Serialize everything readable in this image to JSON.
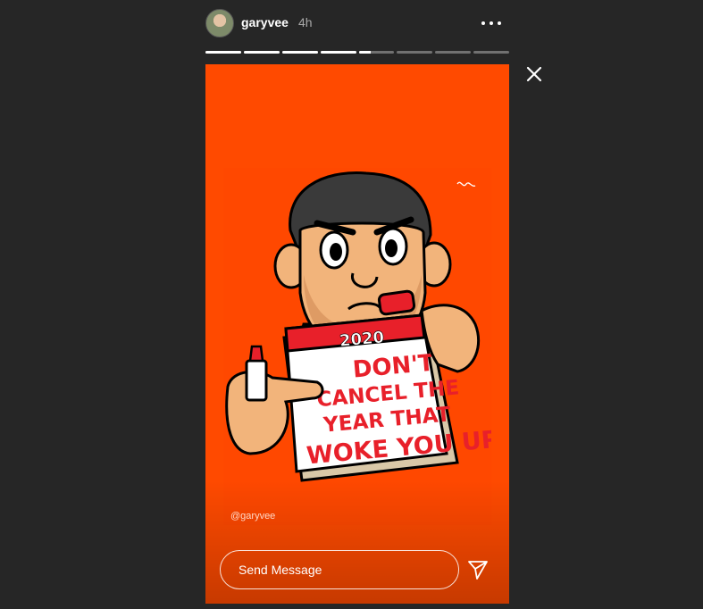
{
  "header": {
    "username": "garyvee",
    "time": "4h"
  },
  "progress": {
    "segments": [
      1,
      1,
      1,
      1,
      0.35,
      0,
      0,
      0
    ]
  },
  "story": {
    "artwork": {
      "calendar_year": "2020",
      "caption_lines": [
        "DON'T",
        "CANCEL THE",
        "YEAR THAT",
        "WOKE YOU UP!"
      ]
    },
    "handle": "@garyvee"
  },
  "reply": {
    "placeholder": "Send Message"
  },
  "icons": {
    "more": "more-options-icon",
    "close": "close-icon",
    "send": "send-icon"
  },
  "colors": {
    "story_bg": "#ff4a00",
    "page_bg": "#262626",
    "accent_red": "#e8202a"
  }
}
